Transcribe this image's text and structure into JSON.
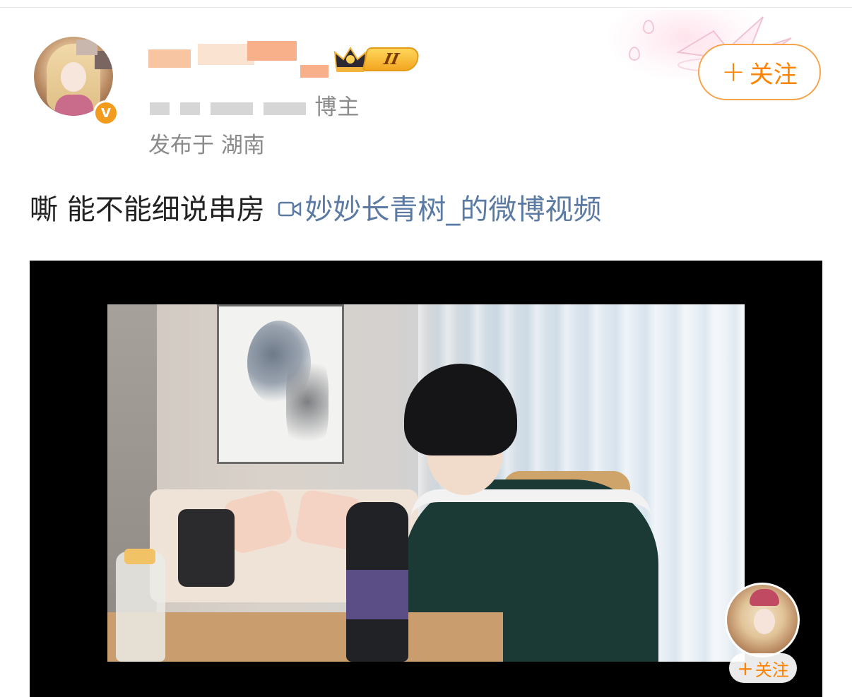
{
  "post": {
    "meta_partial": "26-9-4 23:55 · 原博主",
    "meta_suffix": "博主",
    "location": "发布于 湖南",
    "text": "嘶 能不能细说串房",
    "video_link": "妙妙长青树_的微博视频",
    "badge_level": "II"
  },
  "follow": {
    "label": "关注",
    "plus": "+"
  },
  "pip": {
    "follow_label": "关注",
    "plus": "+"
  },
  "icons": {
    "verified": "verified-badge-icon",
    "crown": "crown-icon",
    "camera": "video-camera-icon",
    "plus": "plus-icon"
  },
  "colors": {
    "accent": "#ff8200",
    "accent_border": "#f6a34a",
    "link": "#5b7aa3",
    "meta": "#8a8a8a"
  }
}
